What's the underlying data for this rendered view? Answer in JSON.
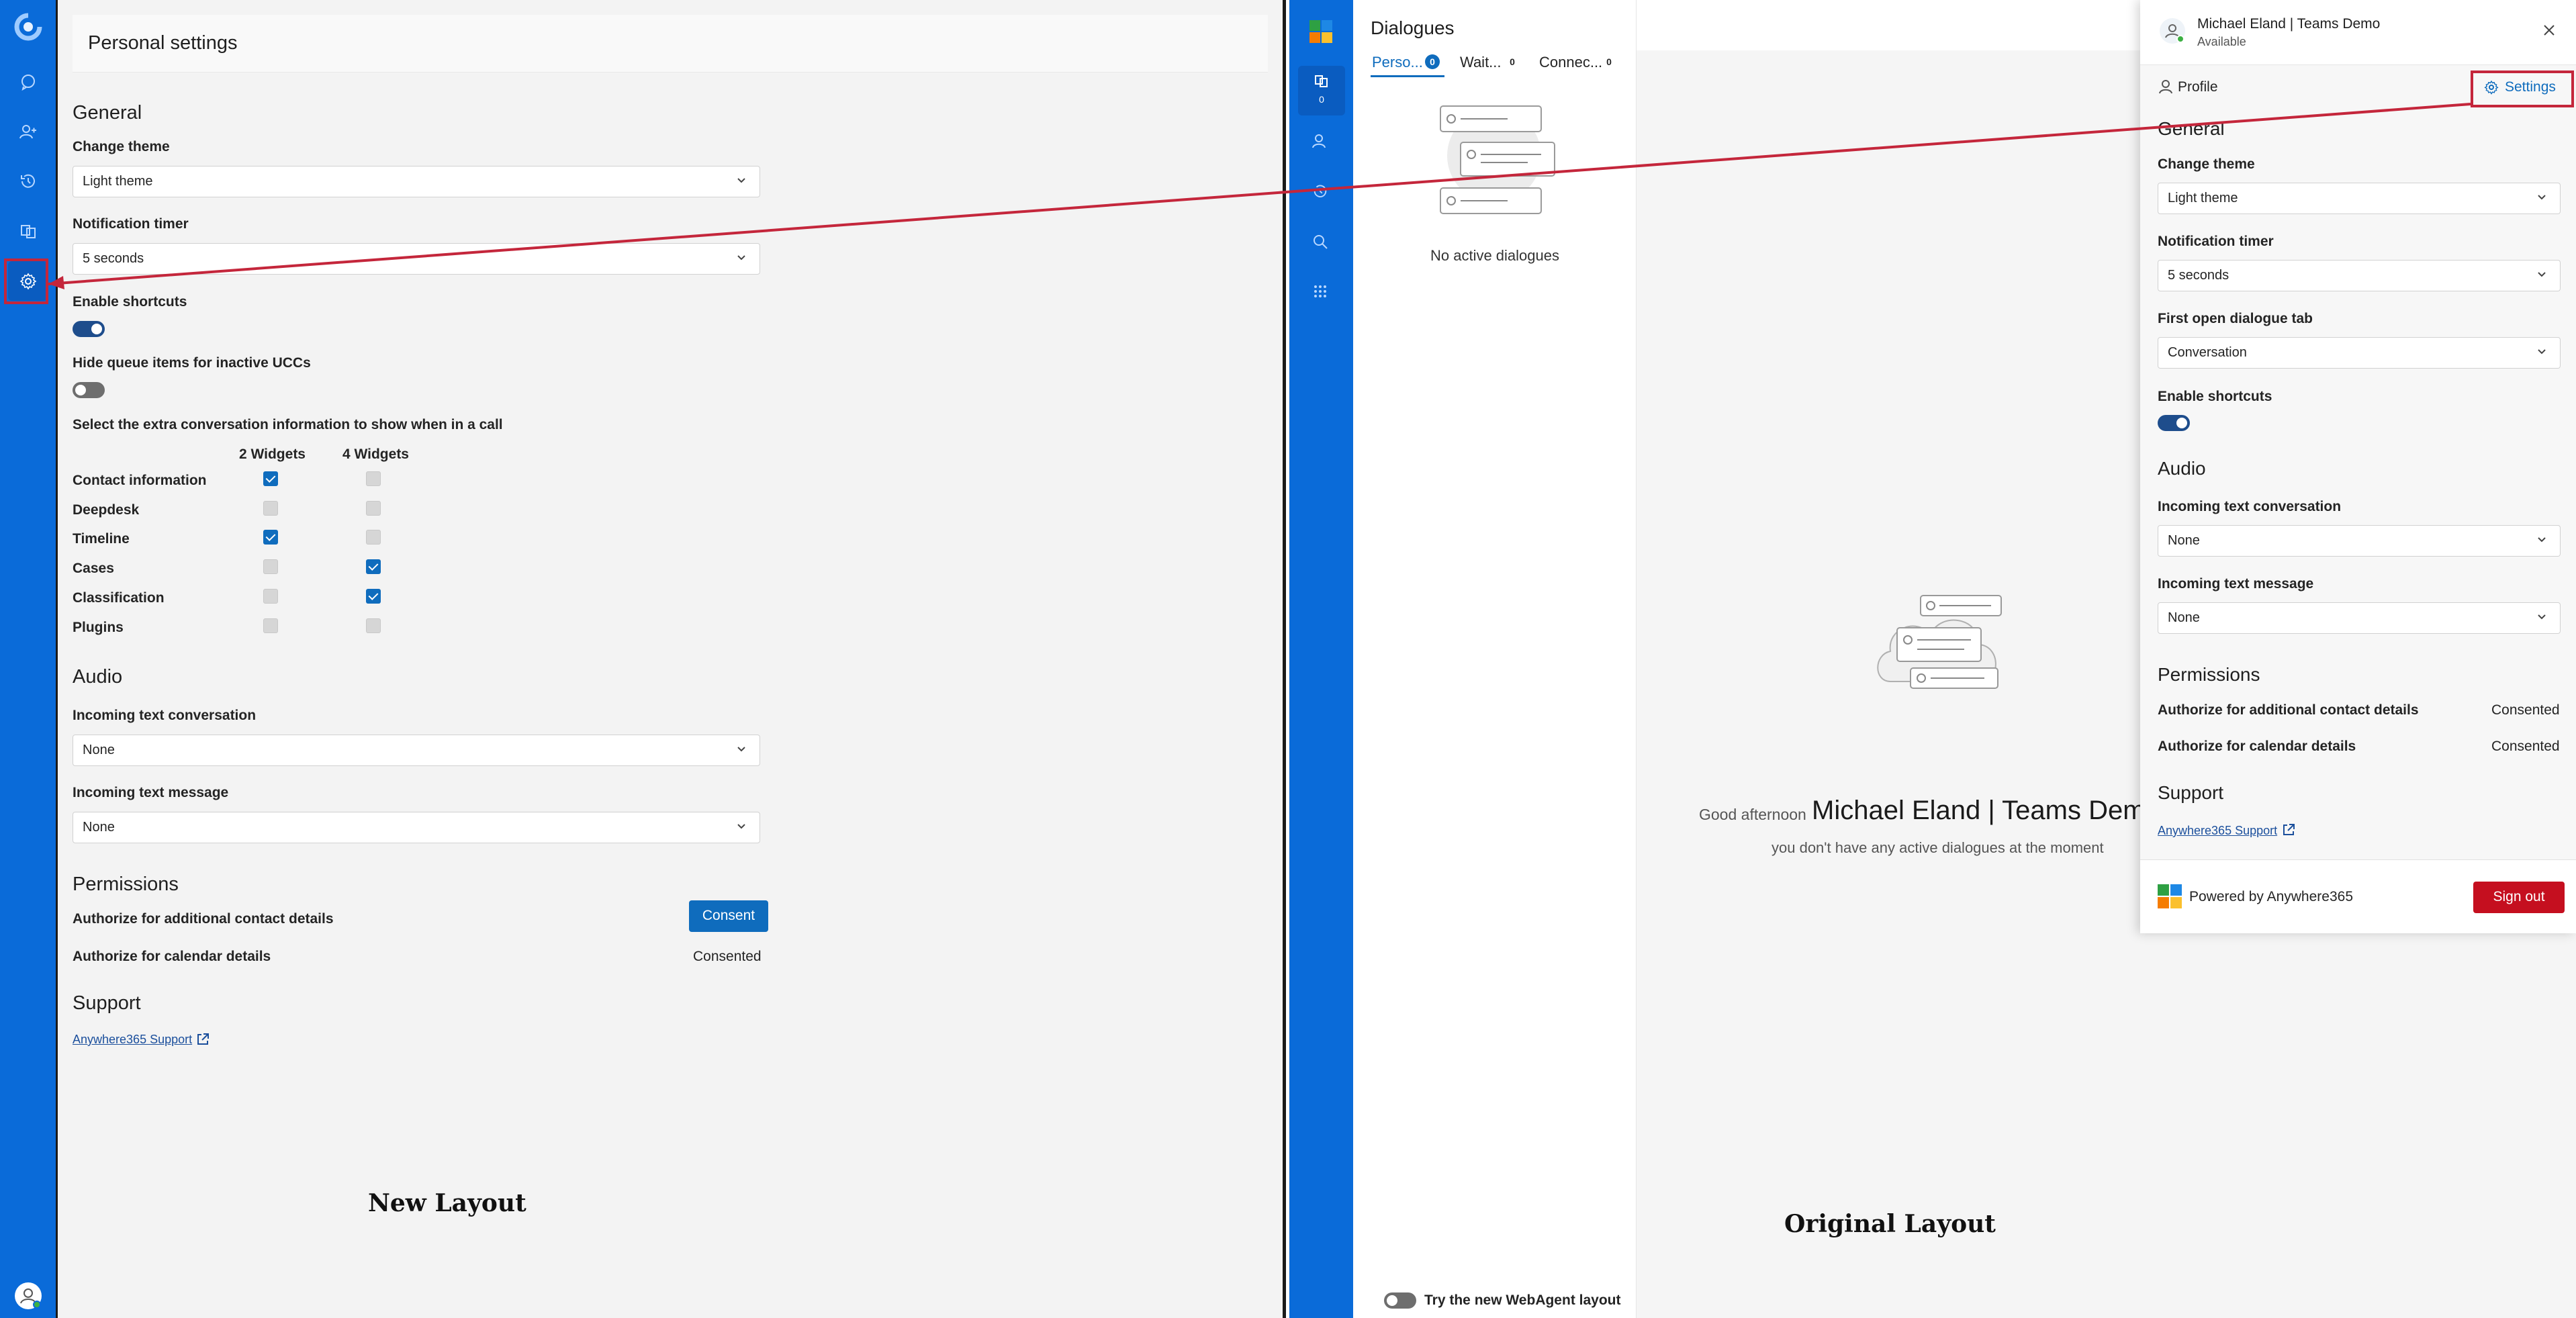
{
  "new_layout": {
    "caption": "New Layout",
    "page_title": "Personal settings",
    "general": {
      "heading": "General",
      "change_theme_label": "Change theme",
      "change_theme_value": "Light theme",
      "notification_timer_label": "Notification timer",
      "notification_timer_value": "5 seconds",
      "enable_shortcuts_label": "Enable shortcuts",
      "enable_shortcuts_on": true,
      "hide_queue_label": "Hide queue items for inactive UCCs",
      "hide_queue_on": false,
      "extra_info_label": "Select the extra conversation information to show when in a call",
      "col_2_widgets": "2 Widgets",
      "col_4_widgets": "4 Widgets",
      "rows": [
        {
          "label": "Contact information",
          "w2": true,
          "w4": false
        },
        {
          "label": "Deepdesk",
          "w2": false,
          "w4": false
        },
        {
          "label": "Timeline",
          "w2": true,
          "w4": false
        },
        {
          "label": "Cases",
          "w2": false,
          "w4": true
        },
        {
          "label": "Classification",
          "w2": false,
          "w4": true
        },
        {
          "label": "Plugins",
          "w2": false,
          "w4": false
        }
      ]
    },
    "audio": {
      "heading": "Audio",
      "incoming_conv_label": "Incoming text conversation",
      "incoming_conv_value": "None",
      "incoming_msg_label": "Incoming text message",
      "incoming_msg_value": "None"
    },
    "permissions": {
      "heading": "Permissions",
      "contact_label": "Authorize for additional contact details",
      "contact_button": "Consent",
      "calendar_label": "Authorize for calendar details",
      "calendar_status": "Consented"
    },
    "support": {
      "heading": "Support",
      "link": "Anywhere365 Support"
    }
  },
  "original_layout": {
    "caption": "Original Layout",
    "dialogues": {
      "title": "Dialogues",
      "tabs": [
        {
          "label": "Perso...",
          "count": "0"
        },
        {
          "label": "Wait...",
          "count": "0"
        },
        {
          "label": "Connec...",
          "count": "0"
        }
      ],
      "empty_text": "No active dialogues",
      "rail_badge": "0",
      "try_new_layout": "Try the new WebAgent layout"
    },
    "greeting": "Good afternoon",
    "user_name_big": "Michael Eland | Teams Dem",
    "no_dialogues_sub": "you don't have any active dialogues at the moment",
    "flyout": {
      "user_name": "Michael Eland | Teams Demo",
      "presence": "Available",
      "profile_tab": "Profile",
      "settings_tab": "Settings",
      "general_heading": "General",
      "change_theme_label": "Change theme",
      "change_theme_value": "Light theme",
      "notification_timer_label": "Notification timer",
      "notification_timer_value": "5 seconds",
      "first_tab_label": "First open dialogue tab",
      "first_tab_value": "Conversation",
      "enable_shortcuts_label": "Enable shortcuts",
      "audio_heading": "Audio",
      "incoming_conv_label": "Incoming text conversation",
      "incoming_conv_value": "None",
      "incoming_msg_label": "Incoming text message",
      "incoming_msg_value": "None",
      "permissions_heading": "Permissions",
      "contact_label": "Authorize for additional contact details",
      "contact_status": "Consented",
      "calendar_label": "Authorize for calendar details",
      "calendar_status": "Consented",
      "support_heading": "Support",
      "support_link": "Anywhere365 Support",
      "powered_by": "Powered by Anywhere365",
      "sign_out": "Sign out"
    }
  },
  "colors": {
    "rail_blue": "#0a6bd9",
    "accent": "#0f6cbd",
    "annotation_red": "#c4263b",
    "sign_out_red": "#c50f1f"
  }
}
